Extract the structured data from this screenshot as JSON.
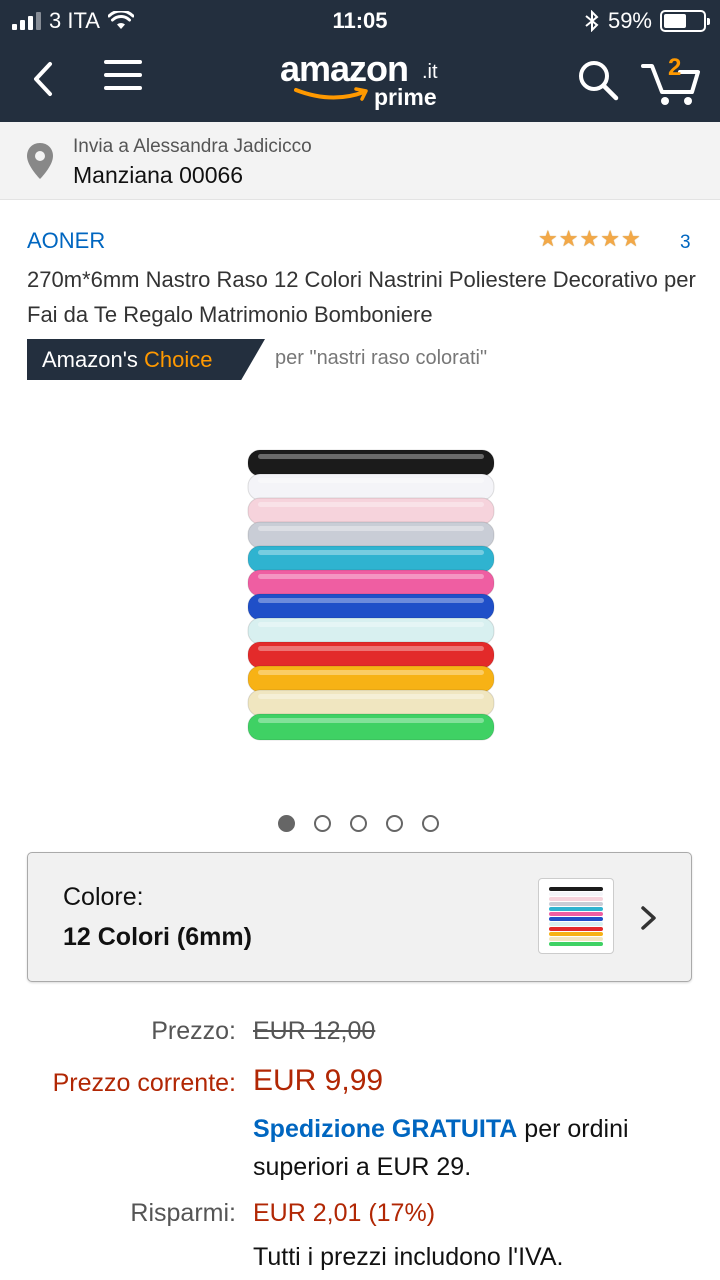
{
  "status": {
    "carrier": "3 ITA",
    "time": "11:05",
    "battery": "59%",
    "battery_level": 0.59
  },
  "nav": {
    "logo_word": "amazon",
    "logo_tld": ".it",
    "logo_sub": "prime",
    "cart_count": "2"
  },
  "delivery": {
    "line1": "Invia a Alessandra Jadicicco",
    "line2": "Manziana 00066"
  },
  "product": {
    "brand": "AONER",
    "rating_stars": 5,
    "rating_count": "3",
    "title": "270m*6mm Nastro Raso 12 Colori Nastrini Poliestere Decorativo per Fai da Te Regalo Matrimonio Bomboniere",
    "choice_prefix": "Amazon's",
    "choice_word": "Choice",
    "choice_query": "per \"nastri raso colorati\"",
    "image_count": 5,
    "image_active": 1,
    "ribbon_colors": [
      "#1b1b1b",
      "#f4f4f8",
      "#f6d3dc",
      "#c9cdd6",
      "#2fb3d0",
      "#ef5ea2",
      "#1f4fc8",
      "#d8f0f0",
      "#e32a2a",
      "#f7b215",
      "#f0e6c0",
      "#3fd164"
    ]
  },
  "color_selector": {
    "label": "Colore:",
    "value": "12 Colori (6mm)"
  },
  "pricing": {
    "list_label": "Prezzo:",
    "list_price": "EUR 12,00",
    "current_label": "Prezzo corrente:",
    "current_price": "EUR 9,99",
    "shipping_link": "Spedizione GRATUITA",
    "shipping_rest1": "per ordini",
    "shipping_rest2": "superiori a EUR 29.",
    "savings_label": "Risparmi:",
    "savings_value": "EUR 2,01 (17%)",
    "vat_note": "Tutti i prezzi includono l'IVA."
  },
  "colors": {
    "header_bg": "#232f3e",
    "accent_orange": "#ff9900",
    "link_blue": "#0066c0",
    "price_red": "#b12704"
  }
}
